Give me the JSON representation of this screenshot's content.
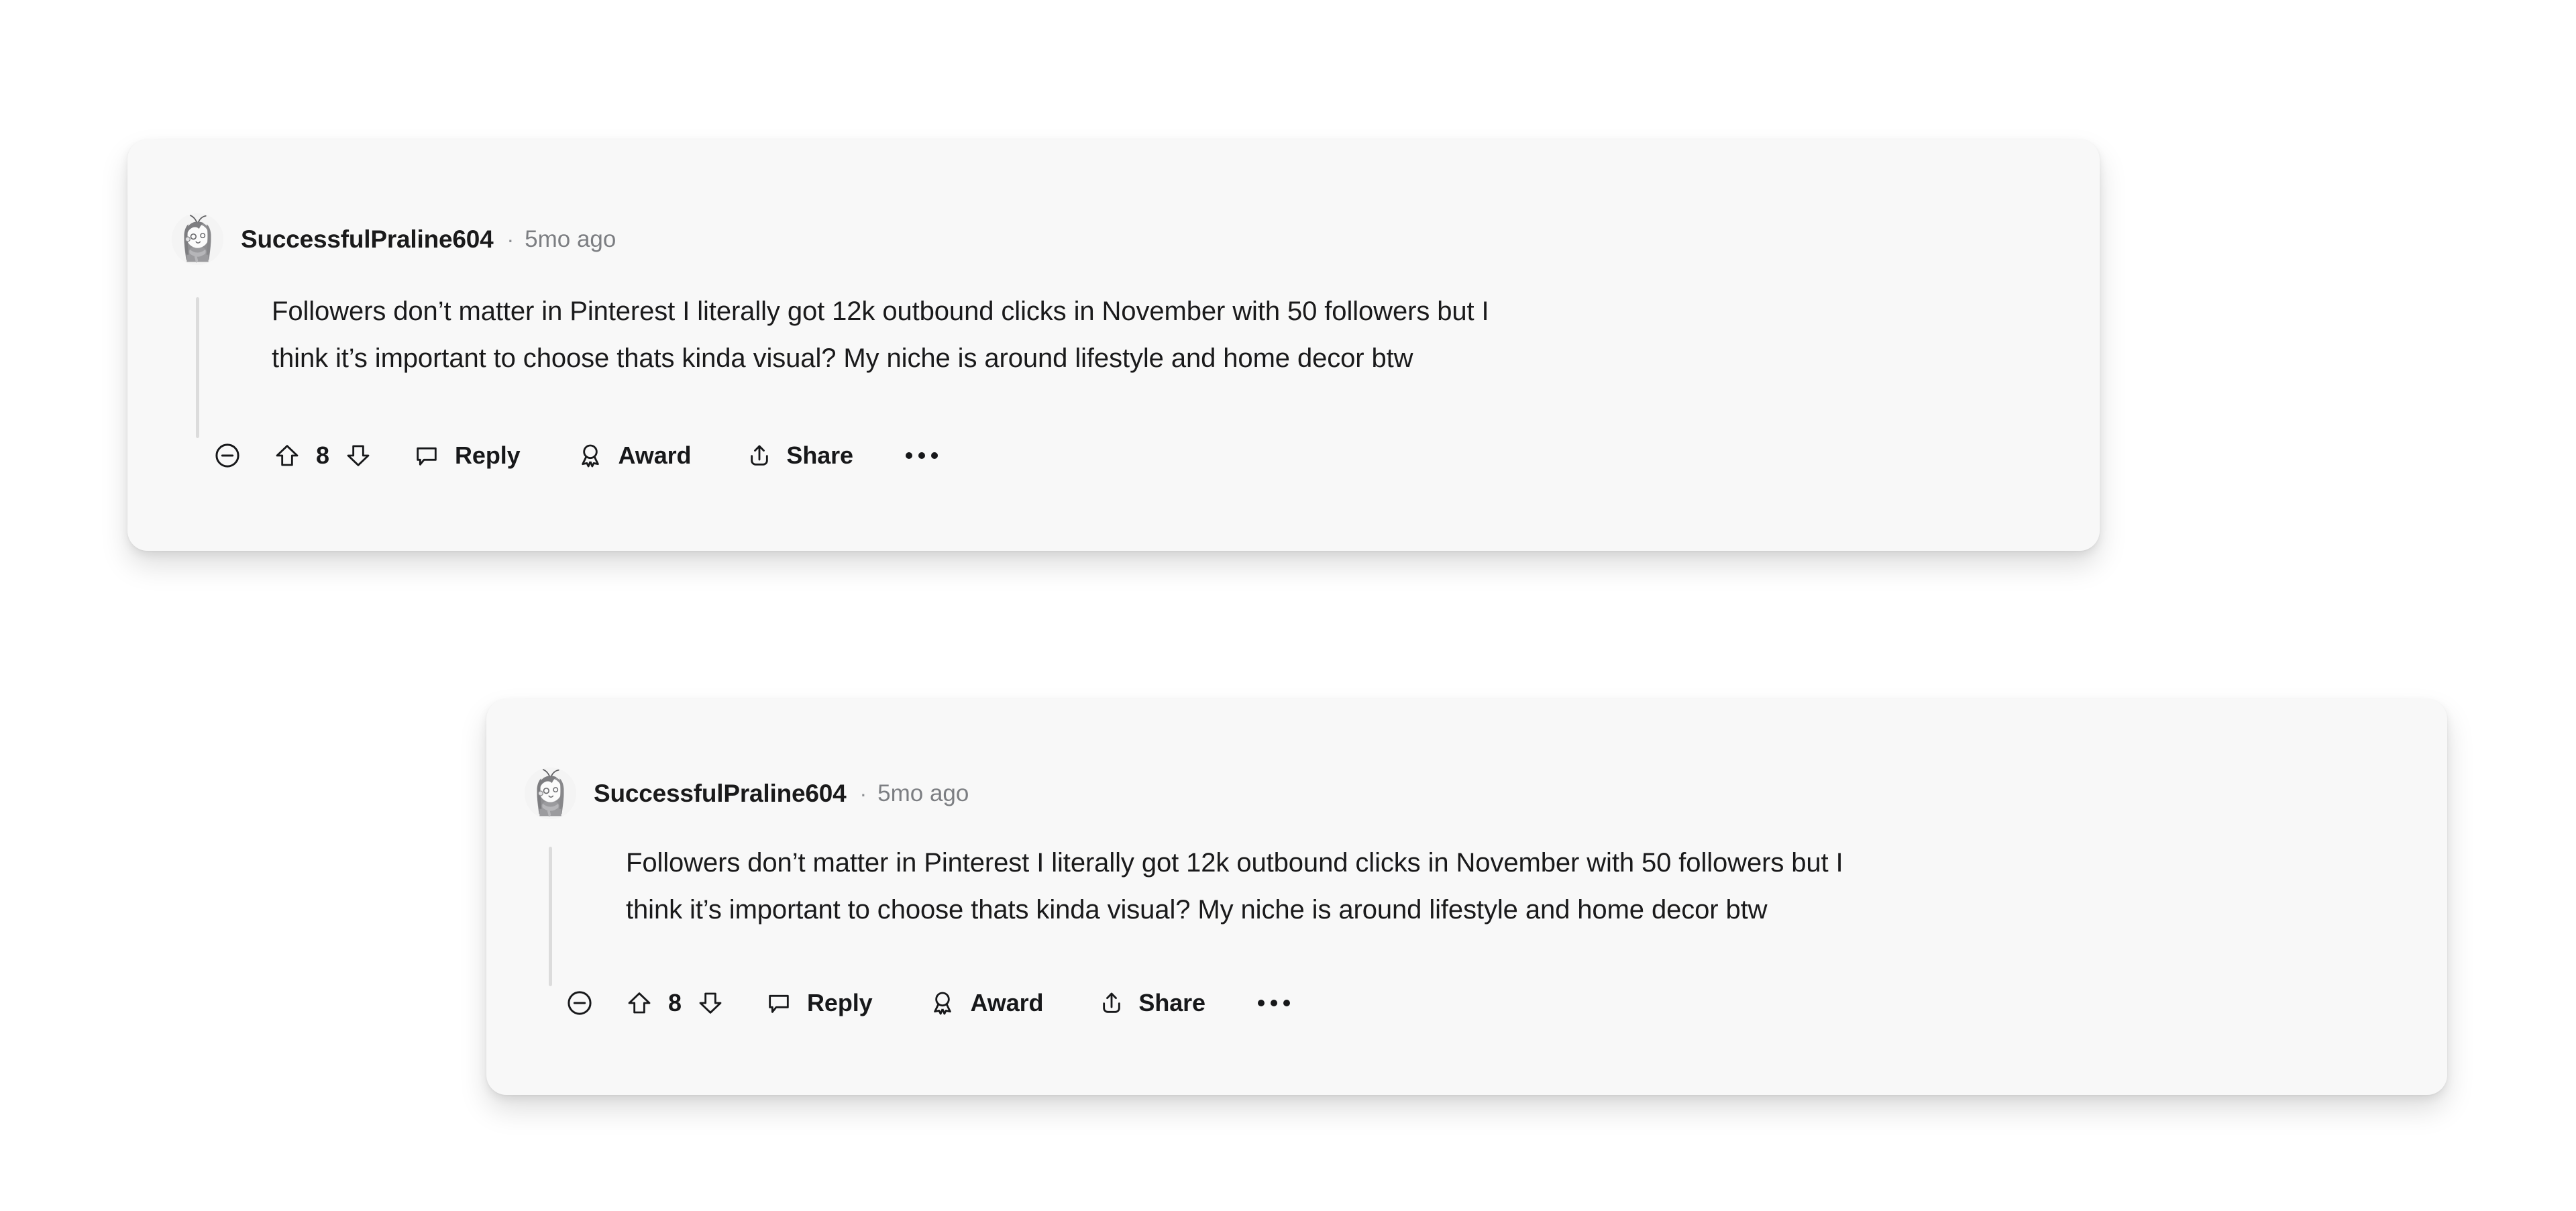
{
  "background_color": "#ffffff",
  "card_color": "#f8f8f8",
  "text_color": "#1a1a1b",
  "muted_color": "#7c7e82",
  "comments": [
    {
      "author": "SuccessfulPraline604",
      "separator": "·",
      "timestamp": "5mo ago",
      "avatar_alt": "cartoon-avatar",
      "body_lines": [
        "Followers don’t matter in Pinterest I literally got 12k outbound clicks in November with 50 followers but I",
        "think it’s important to choose thats kinda visual? My niche is around lifestyle and home decor btw"
      ],
      "actions": {
        "collapse_icon": "circle-minus-icon",
        "upvote_icon": "upvote-arrow-icon",
        "vote_count": "8",
        "downvote_icon": "downvote-arrow-icon",
        "reply_label": "Reply",
        "reply_icon": "comment-bubble-icon",
        "award_label": "Award",
        "award_icon": "award-rosette-icon",
        "share_label": "Share",
        "share_icon": "share-upload-icon",
        "overflow_icon": "more-horizontal-icon"
      }
    },
    {
      "author": "SuccessfulPraline604",
      "separator": "·",
      "timestamp": "5mo ago",
      "avatar_alt": "cartoon-avatar",
      "body_lines": [
        "Followers don’t matter in Pinterest I literally got 12k outbound clicks in November with 50 followers but I",
        "think it’s important to choose thats kinda visual? My niche is around lifestyle and home decor btw"
      ],
      "actions": {
        "collapse_icon": "circle-minus-icon",
        "upvote_icon": "upvote-arrow-icon",
        "vote_count": "8",
        "downvote_icon": "downvote-arrow-icon",
        "reply_label": "Reply",
        "reply_icon": "comment-bubble-icon",
        "award_label": "Award",
        "award_icon": "award-rosette-icon",
        "share_label": "Share",
        "share_icon": "share-upload-icon",
        "overflow_icon": "more-horizontal-icon"
      }
    }
  ]
}
